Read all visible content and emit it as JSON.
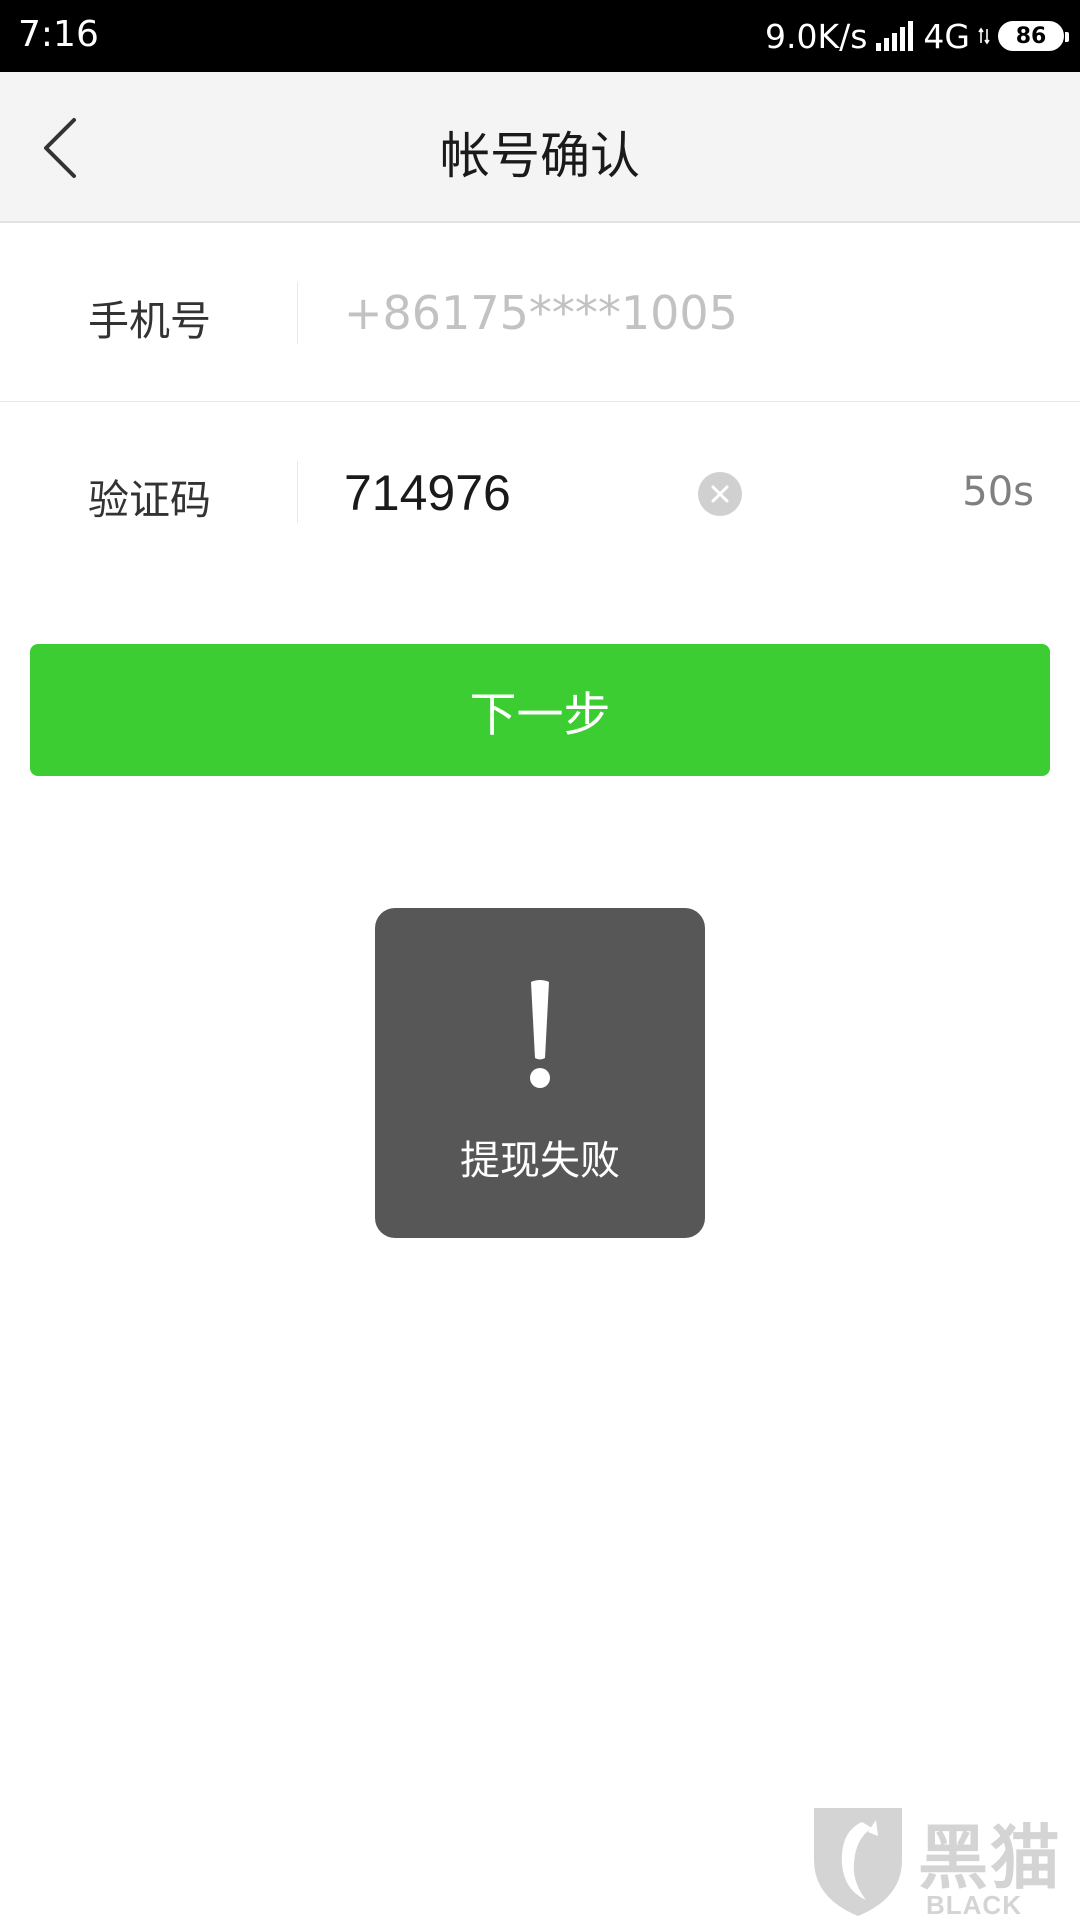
{
  "status_bar": {
    "time": "7:16",
    "network_speed": "9.0K/s",
    "network_type": "4G",
    "battery_level": "86"
  },
  "nav": {
    "title": "帐号确认",
    "back_icon": "chevron-left-icon"
  },
  "form": {
    "phone": {
      "label": "手机号",
      "value": "+86175****1005"
    },
    "code": {
      "label": "验证码",
      "value": "714976",
      "clear_icon": "clear-icon",
      "countdown": "50s"
    }
  },
  "next_button": {
    "label": "下一步"
  },
  "toast": {
    "icon": "exclamation-icon",
    "message": "提现失败"
  },
  "watermark": {
    "title": "黑猫",
    "subtitle": "BLACK CAT"
  },
  "colors": {
    "primary_green": "#3ccd32",
    "nav_background": "#f4f4f4",
    "toast_background": "#575757",
    "placeholder_grey": "#c2c2c2"
  }
}
